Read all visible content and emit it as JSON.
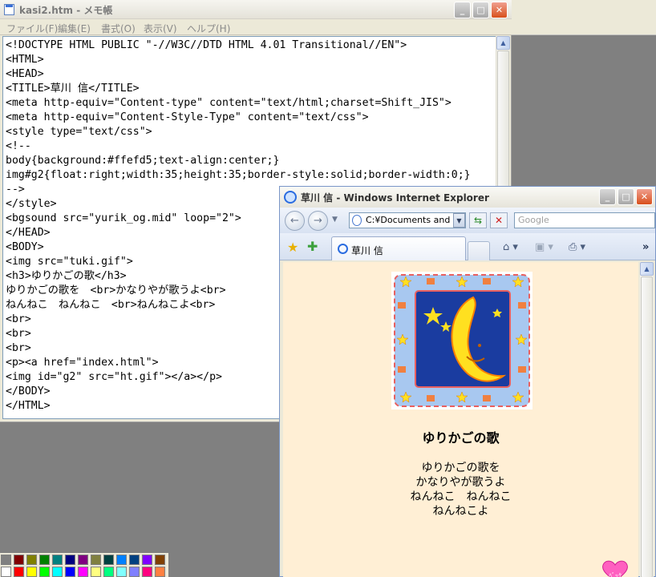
{
  "notepad": {
    "title": "kasi2.htm - メモ帳",
    "menu": [
      "ファイル(F)",
      "編集(E)",
      "書式(O)",
      "表示(V)",
      "ヘルプ(H)"
    ],
    "lines": [
      "<!DOCTYPE HTML PUBLIC \"-//W3C//DTD HTML 4.01 Transitional//EN\">",
      "<HTML>",
      "<HEAD>",
      "<TITLE>草川 信</TITLE>",
      "<meta http-equiv=\"Content-type\" content=\"text/html;charset=Shift_JIS\">",
      "<meta http-equiv=\"Content-Style-Type\" content=\"text/css\">",
      "<style type=\"text/css\">",
      "<!--",
      "body{background:#ffefd5;text-align:center;}",
      "img#g2{float:right;width:35;height:35;border-style:solid;border-width:0;}",
      "-->",
      "</style>",
      "<bgsound src=\"yurik_og.mid\" loop=\"2\">",
      "</HEAD>",
      "<BODY>",
      "<img src=\"tuki.gif\">",
      "<h3>ゆりかごの歌</h3>",
      "ゆりかごの歌を　<br>かなりやが歌うよ<br>",
      "ねんねこ　ねんねこ　<br>ねんねこよ<br>",
      "<br>",
      "<br>",
      "<br>",
      "<p><a href=\"index.html\">",
      "<img id=\"g2\" src=\"ht.gif\"></a></p>",
      "</BODY>",
      "</HTML>"
    ]
  },
  "ie": {
    "title": "草川 信 - Windows Internet Explorer",
    "address": "C:¥Documents and S",
    "search_placeholder": "Google",
    "tab_label": "草川 信",
    "page": {
      "heading": "ゆりかごの歌",
      "lyrics": [
        "ゆりかごの歌を",
        "かなりやが歌うよ",
        "ねんねこ　ねんねこ",
        "ねんねこよ"
      ],
      "background": "#ffefd5"
    }
  },
  "palette_colors": [
    "#808080",
    "#800000",
    "#808000",
    "#008000",
    "#008080",
    "#000080",
    "#800080",
    "#808040",
    "#004040",
    "#0080ff",
    "#004080",
    "#8000ff",
    "#804000",
    "#ffffff",
    "#ff0000",
    "#ffff00",
    "#00ff00",
    "#00ffff",
    "#0000ff",
    "#ff00ff",
    "#ffff80",
    "#00ff80",
    "#80ffff",
    "#8080ff",
    "#ff0080",
    "#ff8040"
  ]
}
